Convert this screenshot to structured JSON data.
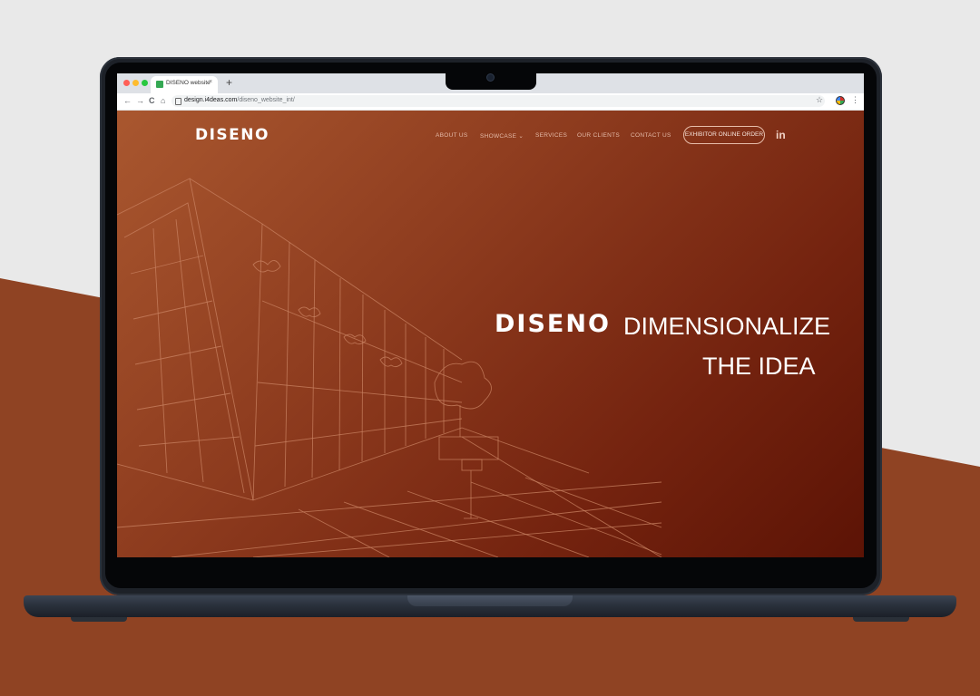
{
  "browser": {
    "tab_title": "DISENO website",
    "tab_close": "×",
    "new_tab": "+",
    "url_host": "design.i4deas.com",
    "url_path": "/diseno_website_int/",
    "nav_back": "←",
    "nav_forward": "→",
    "nav_reload": "C",
    "nav_home": "⌂",
    "star": "☆",
    "menu": "⋮"
  },
  "site": {
    "logo": "DISENO",
    "nav": [
      "ABOUT US",
      "SHOWCASE ⌄",
      "SERVICES",
      "OUR CLIENTS",
      "CONTACT US"
    ],
    "cta": "EXHIBITOR ONLINE ORDER",
    "social": "in"
  },
  "hero": {
    "brand": "DISENO",
    "tagline_line1": "DIMENSIONALIZE",
    "tagline_line2": "THE IDEA"
  },
  "colors": {
    "brand_background": "#8d3b1e",
    "outer_background": "#8f4323"
  }
}
